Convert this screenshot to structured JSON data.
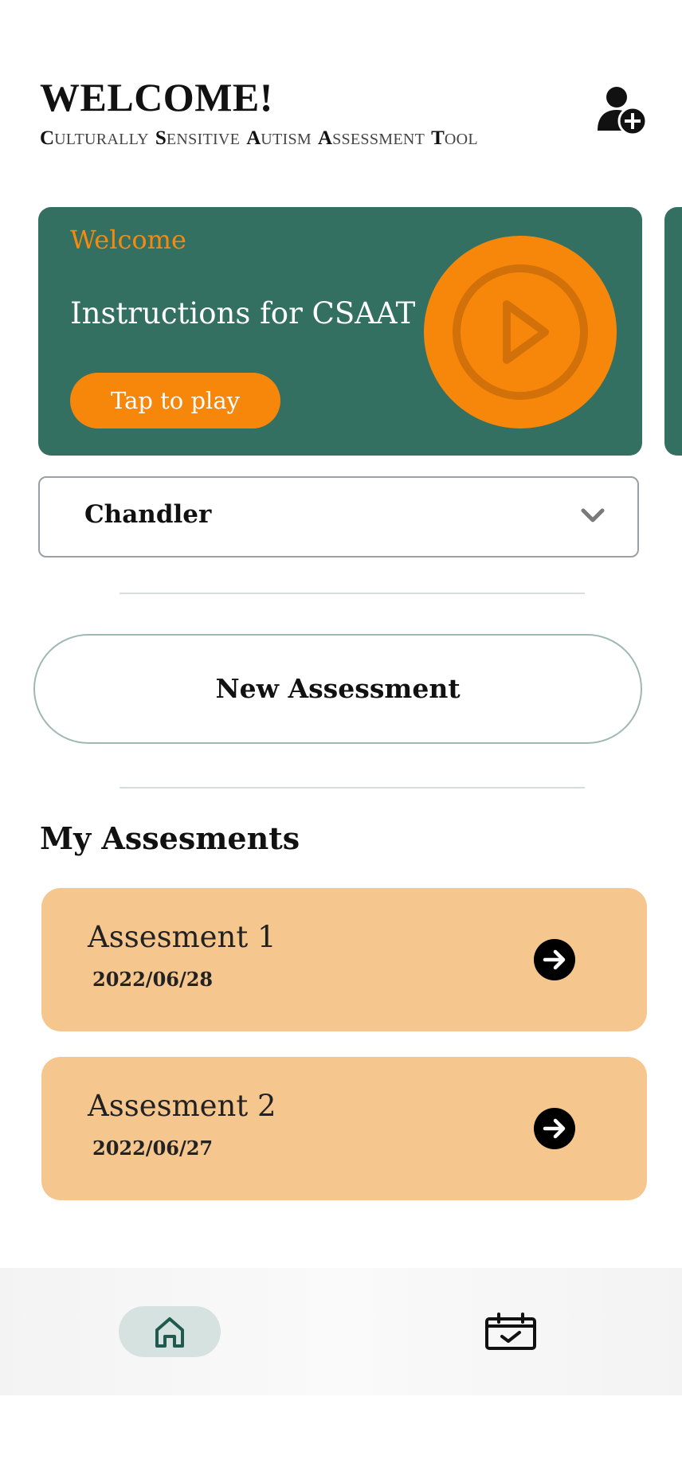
{
  "header": {
    "title": "WELCOME!",
    "subtitle_words": [
      {
        "initial": "C",
        "rest": "ULTURALLY"
      },
      {
        "initial": "S",
        "rest": "ENSITIVE"
      },
      {
        "initial": "A",
        "rest": "UTISM"
      },
      {
        "initial": "A",
        "rest": "SSESSMENT"
      },
      {
        "initial": "T",
        "rest": "OOL"
      }
    ],
    "add_user_icon": "add-user-icon"
  },
  "banner": {
    "kicker": "Welcome",
    "title": "Instructions for CSAAT",
    "play_button_label": "Tap to play",
    "play_icon": "play-circle-icon",
    "colors": {
      "background": "#347062",
      "accent": "#f7870a"
    }
  },
  "child_select": {
    "value": "Chandler",
    "icon": "chevron-down-icon"
  },
  "new_assessment_label": "New Assessment",
  "my_assessments": {
    "title": "My Assesments",
    "items": [
      {
        "name": "Assesment 1",
        "date": "2022/06/28"
      },
      {
        "name": "Assesment 2",
        "date": "2022/06/27"
      }
    ],
    "card_color": "#f6c68f"
  },
  "tabbar": {
    "tabs": [
      {
        "icon": "home-icon",
        "active": true
      },
      {
        "icon": "calendar-check-icon",
        "active": false
      }
    ]
  }
}
